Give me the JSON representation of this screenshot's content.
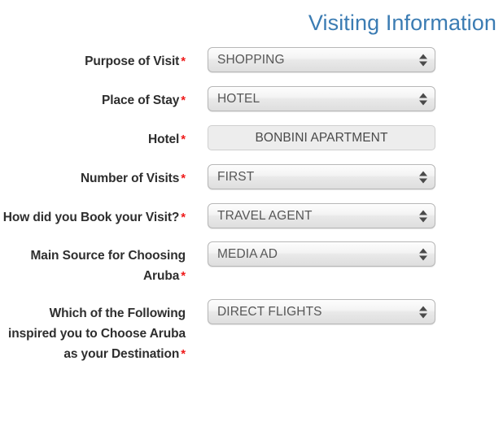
{
  "header": {
    "title": "Visiting Information",
    "title_color": "#3b7cb3"
  },
  "form": {
    "required_marker": "*",
    "required_color": "#ef1a1a",
    "rows": [
      {
        "label": "Purpose of Visit",
        "required": true,
        "control": "select",
        "value": "SHOPPING",
        "icon": "stepper-updown-icon"
      },
      {
        "label": "Place of Stay",
        "required": true,
        "control": "select",
        "value": "HOTEL",
        "icon": "stepper-updown-icon"
      },
      {
        "label": "Hotel",
        "required": true,
        "control": "text",
        "value": "BONBINI APARTMENT",
        "icon": ""
      },
      {
        "label": "Number of Visits",
        "required": true,
        "control": "select",
        "value": "FIRST",
        "icon": "stepper-updown-icon"
      },
      {
        "label": "How did you Book your Visit?",
        "required": true,
        "control": "select",
        "value": "TRAVEL AGENT",
        "icon": "stepper-updown-icon"
      },
      {
        "label": "Main Source for Choosing Aruba",
        "required": true,
        "control": "select",
        "value": "MEDIA AD",
        "icon": "stepper-updown-icon"
      },
      {
        "label": "Which of the Following inspired you to Choose Aruba as your Destination",
        "required": true,
        "control": "select",
        "value": "DIRECT FLIGHTS",
        "icon": "stepper-updown-icon"
      }
    ]
  }
}
